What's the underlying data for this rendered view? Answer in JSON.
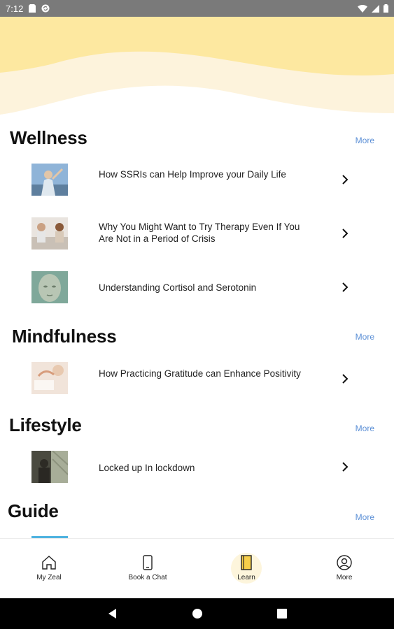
{
  "status_bar": {
    "time": "7:12"
  },
  "sections": [
    {
      "title": "Wellness",
      "more": "More",
      "articles": [
        {
          "title": "How SSRIs can Help Improve your Daily Life"
        },
        {
          "title": "Why You Might Want to Try Therapy Even If You Are Not in a Period of Crisis"
        },
        {
          "title": "Understanding Cortisol and Serotonin"
        }
      ]
    },
    {
      "title": "Mindfulness",
      "more": "More",
      "articles": [
        {
          "title": "How Practicing Gratitude can Enhance Positivity"
        }
      ]
    },
    {
      "title": "Lifestyle",
      "more": "More",
      "articles": [
        {
          "title": "Locked up In lockdown"
        }
      ]
    },
    {
      "title": "Guide",
      "more": "More",
      "articles": []
    }
  ],
  "bottom_nav": [
    {
      "label": "My Zeal",
      "icon": "home-icon",
      "active": false
    },
    {
      "label": "Book a Chat",
      "icon": "phone-icon",
      "active": false
    },
    {
      "label": "Learn",
      "icon": "notebook-icon",
      "active": true
    },
    {
      "label": "More",
      "icon": "profile-icon",
      "active": false
    }
  ],
  "colors": {
    "header_yellow": "#fde8a0",
    "header_cream": "#fdf3dc",
    "more_link": "#5b8fd6",
    "active_nav_bg": "#fdf5dc"
  }
}
